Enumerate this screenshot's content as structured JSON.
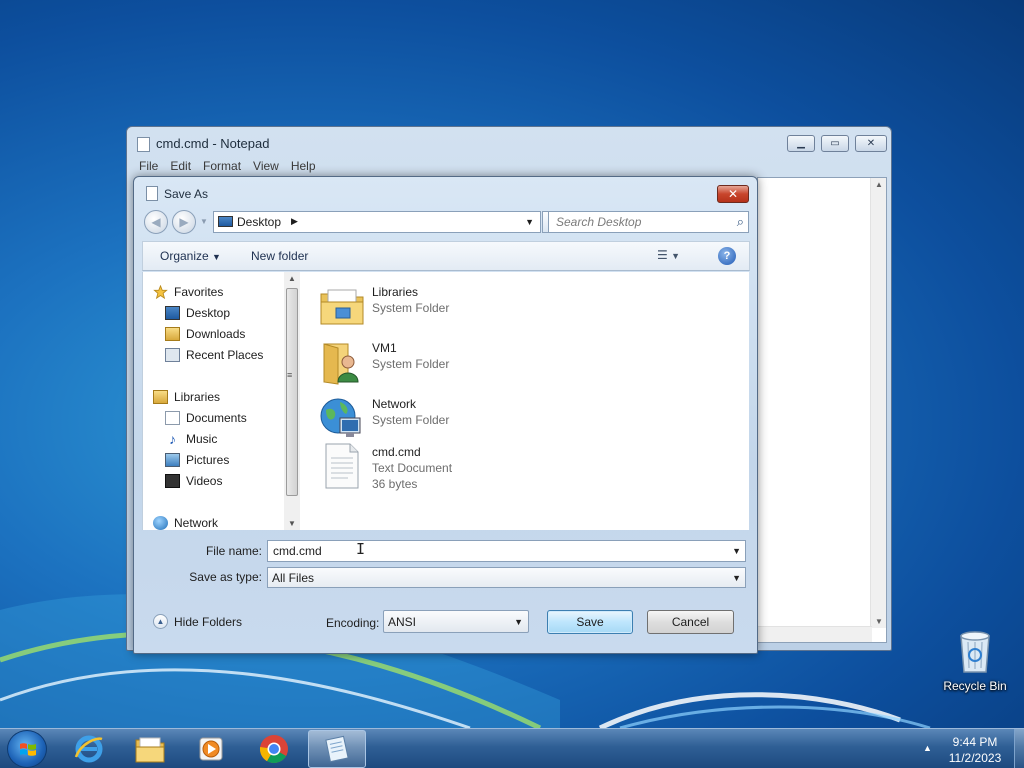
{
  "desktop": {
    "icons": [
      {
        "label": "Recycle Bin",
        "icon": "recycle-bin-icon"
      }
    ]
  },
  "notepad": {
    "title": "cmd.cmd - Notepad",
    "menu": [
      "File",
      "Edit",
      "Format",
      "View",
      "Help"
    ]
  },
  "dialog": {
    "title": "Save As",
    "address": {
      "location": "Desktop"
    },
    "search": {
      "placeholder": "Search Desktop"
    },
    "toolbar": {
      "organize": "Organize",
      "new_folder": "New folder"
    },
    "nav": {
      "favorites": {
        "label": "Favorites",
        "items": [
          "Desktop",
          "Downloads",
          "Recent Places"
        ]
      },
      "libraries": {
        "label": "Libraries",
        "items": [
          "Documents",
          "Music",
          "Pictures",
          "Videos"
        ]
      },
      "network": {
        "label": "Network"
      }
    },
    "files": [
      {
        "name": "Libraries",
        "type": "System Folder",
        "size": "",
        "icon": "libraries-folder-icon"
      },
      {
        "name": "VM1",
        "type": "System Folder",
        "size": "",
        "icon": "user-folder-icon"
      },
      {
        "name": "Network",
        "type": "System Folder",
        "size": "",
        "icon": "network-globe-icon"
      },
      {
        "name": "cmd.cmd",
        "type": "Text Document",
        "size": "36 bytes",
        "icon": "text-document-icon"
      }
    ],
    "form": {
      "file_name_label": "File name:",
      "file_name_value": "cmd.cmd",
      "save_type_label": "Save as type:",
      "save_type_value": "All Files",
      "encoding_label": "Encoding:",
      "encoding_value": "ANSI",
      "hide_folders": "Hide Folders",
      "save": "Save",
      "cancel": "Cancel"
    }
  },
  "taskbar": {
    "pinned": [
      "internet-explorer-icon",
      "windows-explorer-icon",
      "media-player-icon",
      "chrome-icon",
      "notepad-icon"
    ],
    "clock": {
      "time": "9:44 PM",
      "date": "11/2/2023"
    }
  }
}
